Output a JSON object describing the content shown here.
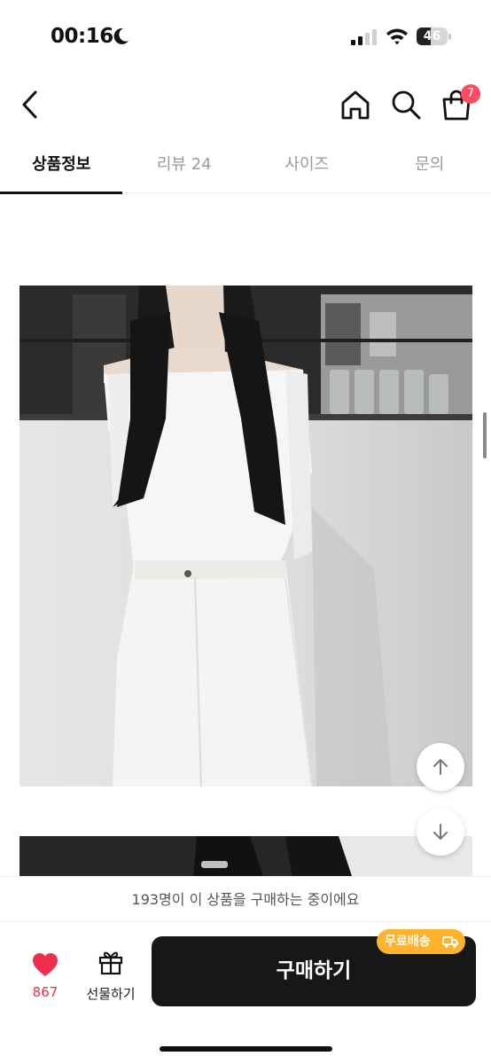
{
  "status_bar": {
    "time": "00:16",
    "battery_level": "46",
    "battery_fraction": 0.46
  },
  "header": {
    "icons": [
      "back-icon",
      "home-icon",
      "search-icon",
      "cart-icon"
    ],
    "cart_badge_count": "7",
    "badge_color": "#ff4b63"
  },
  "tabs": [
    {
      "label": "상품정보",
      "active": true
    },
    {
      "label": "리뷰 24",
      "active": false
    },
    {
      "label": "사이즈",
      "active": false
    },
    {
      "label": "문의",
      "active": false
    }
  ],
  "floating_buttons": {
    "icons": [
      "arrow-up-icon",
      "arrow-down-icon"
    ]
  },
  "purchase_banner": {
    "text": "193명이 이 상품을 구매하는 중이에요"
  },
  "bottom_bar": {
    "like_count": "867",
    "like_color": "#ef2d4c",
    "gift_label": "선물하기",
    "buy_label": "구매하기",
    "free_shipping_label": "무료배송",
    "free_shipping_color": "#ffb32c",
    "icons": [
      "heart-icon",
      "gift-icon",
      "truck-icon"
    ]
  }
}
